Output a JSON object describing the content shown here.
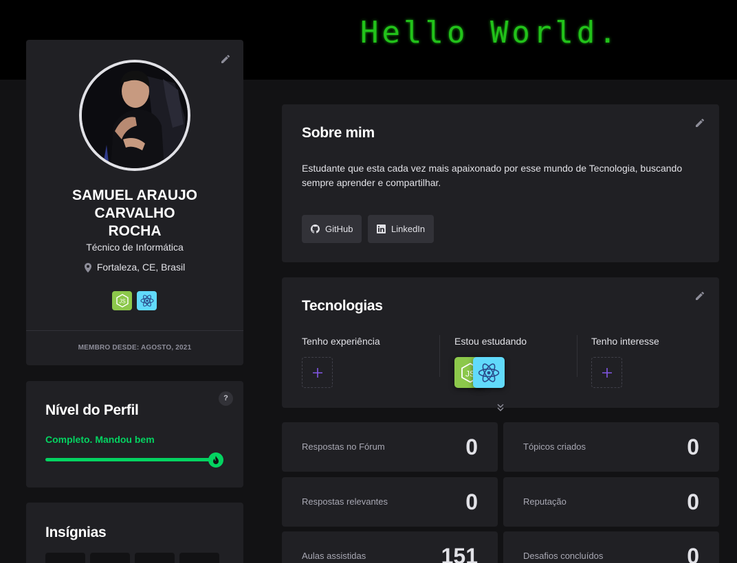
{
  "banner": {
    "text": "Hello World."
  },
  "profile": {
    "name": "SAMUEL ARAUJO CARVALHO ROCHA",
    "role": "Técnico de Informática",
    "location": "Fortaleza, CE, Brasil",
    "technologies": [
      "node-icon",
      "react-icon"
    ],
    "member_since": "MEMBRO DESDE: AGOSTO, 2021"
  },
  "level": {
    "title": "Nível do Perfil",
    "help": "?",
    "status": "Completo. Mandou bem",
    "progress_percent": 100
  },
  "badges": {
    "title": "Insígnias",
    "slot_count": 4
  },
  "about": {
    "title": "Sobre mim",
    "text": "Estudante que esta cada vez mais apaixonado por esse mundo de Tecnologia, buscando sempre aprender e compartilhar.",
    "links": [
      {
        "label": "GitHub",
        "icon": "github-icon"
      },
      {
        "label": "LinkedIn",
        "icon": "linkedin-icon"
      }
    ]
  },
  "technologies": {
    "title": "Tecnologias",
    "columns": [
      {
        "title": "Tenho experiência",
        "items": []
      },
      {
        "title": "Estou estudando",
        "items": [
          "node-icon",
          "react-icon"
        ]
      },
      {
        "title": "Tenho interesse",
        "items": []
      }
    ]
  },
  "stats": [
    {
      "label": "Respostas no Fórum",
      "value": "0"
    },
    {
      "label": "Tópicos criados",
      "value": "0"
    },
    {
      "label": "Respostas relevantes",
      "value": "0"
    },
    {
      "label": "Reputação",
      "value": "0"
    },
    {
      "label": "Aulas assistidas",
      "value": "151"
    },
    {
      "label": "Desafios concluídos",
      "value": "0"
    }
  ],
  "colors": {
    "accent": "#04d361",
    "purple": "#8257e5",
    "node": "#8cc84b",
    "react": "#61dafb",
    "card": "#202024",
    "background": "#121214"
  }
}
